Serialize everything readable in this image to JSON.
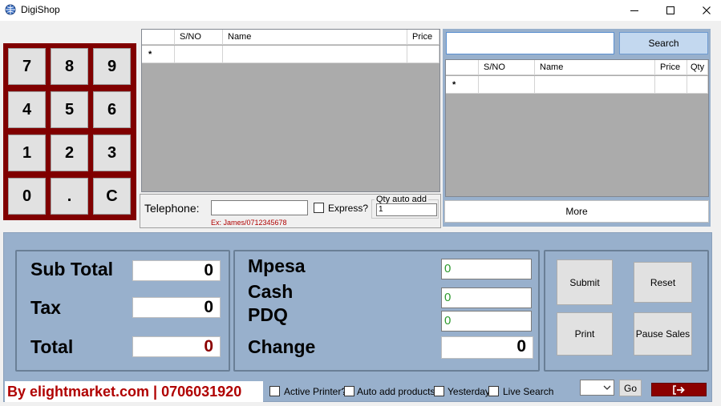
{
  "window": {
    "title": "DigiShop"
  },
  "keypad": {
    "keys": [
      "7",
      "8",
      "9",
      "4",
      "5",
      "6",
      "1",
      "2",
      "3",
      "0",
      ".",
      "C"
    ]
  },
  "left_grid": {
    "columns": [
      "S/NO",
      "Name",
      "Price"
    ],
    "new_row_marker": "*"
  },
  "customer": {
    "telephone_label": "Telephone:",
    "telephone_value": "",
    "hint": "Ex: James/0712345678",
    "express_label": "Express?",
    "qty_auto_add_label": "Qty auto add",
    "qty_auto_add_value": "1"
  },
  "search": {
    "value": "",
    "button_label": "Search"
  },
  "right_grid": {
    "columns": [
      "S/NO",
      "Name",
      "Price",
      "Qty"
    ],
    "new_row_marker": "*"
  },
  "more_button": "More",
  "totals": {
    "subtotal_label": "Sub Total",
    "subtotal_value": "0",
    "tax_label": "Tax",
    "tax_value": "0",
    "total_label": "Total",
    "total_value": "0"
  },
  "payments": {
    "mpesa_label": "Mpesa",
    "mpesa_value": "0",
    "cash_label": "Cash",
    "cash_value": "0",
    "pdq_label": "PDQ",
    "pdq_value": "0",
    "change_label": "Change",
    "change_value": "0"
  },
  "actions": {
    "submit": "Submit",
    "reset": "Reset",
    "print": "Print",
    "pause_sales": "Pause Sales"
  },
  "footer": {
    "brand": "By elightmarket.com | 0706031920",
    "active_printer": "Active Printer?",
    "auto_add_products": "Auto add products?",
    "yesterday": "Yesterday",
    "live_search": "Live Search",
    "go_button": "Go"
  },
  "colors": {
    "keypad_border": "#800000",
    "panel_bg": "#98b0cc",
    "search_button": "#c3d8ef",
    "total_red": "#8b0000",
    "payment_green": "#2e9a2e",
    "brand_red": "#b00000"
  },
  "icons": {
    "app": "globe-icon",
    "minimize": "minimize-icon",
    "maximize": "maximize-icon",
    "close": "close-icon",
    "exit": "exit-icon",
    "dropdown": "chevron-down-icon"
  }
}
